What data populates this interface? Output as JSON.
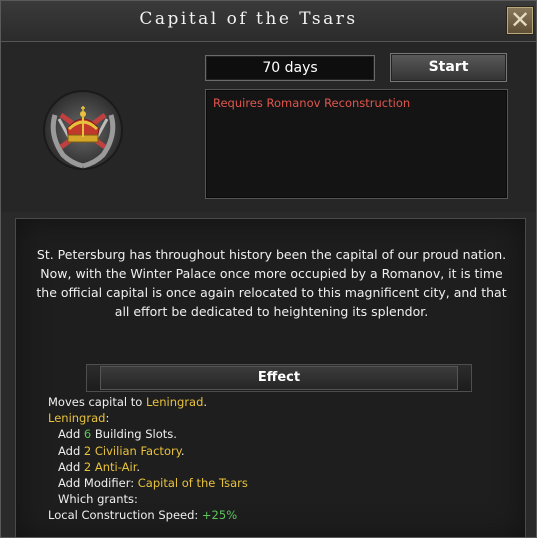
{
  "window": {
    "title": "Capital of the Tsars"
  },
  "focus": {
    "duration": "70 days",
    "start_label": "Start",
    "requirement": "Requires Romanov Reconstruction",
    "icon": "crown-laurel-emblem-icon",
    "description": "St. Petersburg has throughout history been the capital of our proud nation. Now, with the Winter Palace once more occupied by a Romanov, it is time the official capital is once again relocated to this magnificent city, and that all effort be dedicated to heightening its splendor."
  },
  "effect": {
    "header": "Effect",
    "lines": {
      "move_prefix": "Moves capital to ",
      "move_target": "Leningrad",
      "move_suffix": ".",
      "state": "Leningrad",
      "state_suffix": ":",
      "building_prefix": "Add ",
      "building_count": "6",
      "building_suffix": " Building Slots.",
      "civ_prefix": "Add ",
      "civ_value": "2 Civilian Factory",
      "civ_suffix": ".",
      "aa_prefix": "Add ",
      "aa_value": "2 Anti-Air",
      "aa_suffix": ".",
      "modifier_prefix": "Add Modifier: ",
      "modifier_value": "Capital of the Tsars",
      "which_grants": "Which grants:",
      "speed_label": "Local Construction Speed: ",
      "speed_value": "+25%"
    }
  },
  "colors": {
    "requirement": "#e0564e",
    "highlight": "#e8c23c",
    "positive": "#5cc65c"
  }
}
